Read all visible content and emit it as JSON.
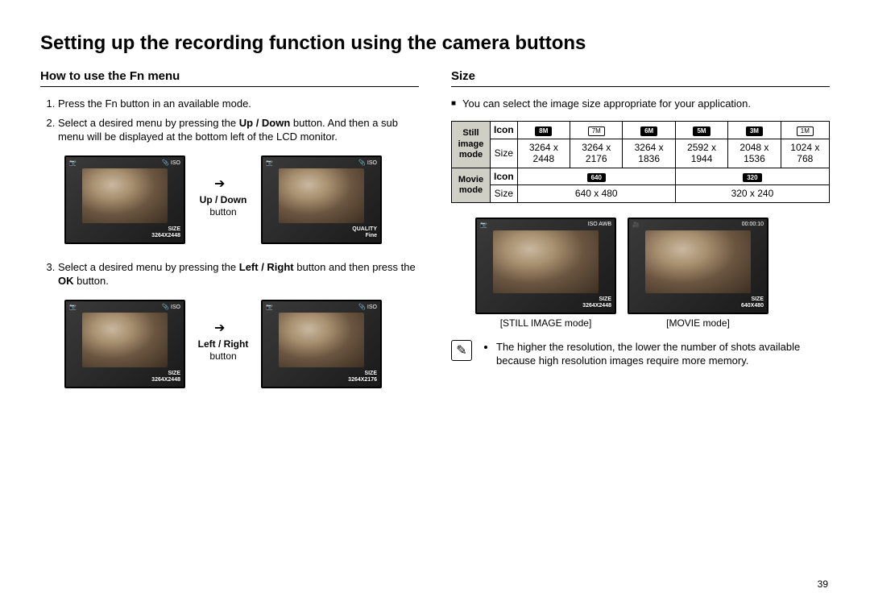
{
  "title": "Setting up the recording function using the camera buttons",
  "page_number": "39",
  "left": {
    "heading": "How to use the Fn menu",
    "steps": {
      "s1": "Press the Fn button in an available mode.",
      "s2_pre": "Select a desired menu by pressing the ",
      "s2_bold": "Up / Down",
      "s2_post": " button. And then a sub menu will be displayed at the bottom left of the LCD monitor.",
      "s3_pre": "Select a desired menu by pressing the ",
      "s3_bold": "Left / Right",
      "s3_post": " button and then press the ",
      "s3_bold2": "OK",
      "s3_post2": " button."
    },
    "labels": {
      "updown_bold": "Up / Down",
      "updown_sub": "button",
      "leftright_bold": "Left / Right",
      "leftright_sub": "button"
    },
    "lcd": {
      "size1": "3264X2448",
      "quality": "Fine",
      "size2": "3264X2448",
      "size3": "3264X2176"
    }
  },
  "right": {
    "heading": "Size",
    "intro": "You can select the image size appropriate for your application.",
    "table": {
      "still_label": "Still image mode",
      "movie_label": "Movie mode",
      "icon_label": "Icon",
      "size_label": "Size",
      "still_icons": [
        "8M",
        "7M",
        "6M",
        "5M",
        "3M",
        "1M"
      ],
      "still_sizes": [
        "3264 x 2448",
        "3264 x 2176",
        "3264 x 1836",
        "2592 x 1944",
        "2048 x 1536",
        "1024 x 768"
      ],
      "movie_icons": [
        "640",
        "320"
      ],
      "movie_sizes": [
        "640 x 480",
        "320 x 240"
      ]
    },
    "modes": {
      "still_cap": "[STILL IMAGE mode]",
      "movie_cap": "[MOVIE mode]",
      "still_overlay": "3264X2448",
      "movie_overlay": "640X480",
      "movie_clock": "00:00:10"
    },
    "note": "The higher the resolution, the lower the number of shots available because high resolution images require more memory."
  }
}
